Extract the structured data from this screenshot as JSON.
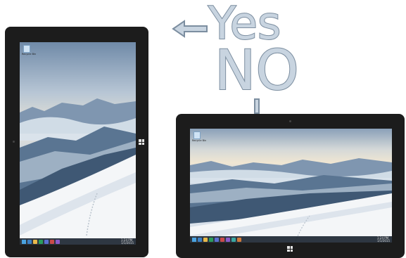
{
  "annotations": {
    "yes": "Yes",
    "no": "NO"
  },
  "desktop": {
    "icon_label": "Recycle Bin",
    "clock_time": "1:24 PM",
    "clock_date": "1/1/2015"
  },
  "colors": {
    "bezel": "#1c1c1c",
    "taskbar": "#12202c",
    "annotation_fill": "#c8d4e0",
    "annotation_stroke": "#7c8ea0"
  },
  "icons": [
    "arrow-left-icon",
    "windows-logo-icon",
    "recycle-bin-icon",
    "camera-icon"
  ]
}
